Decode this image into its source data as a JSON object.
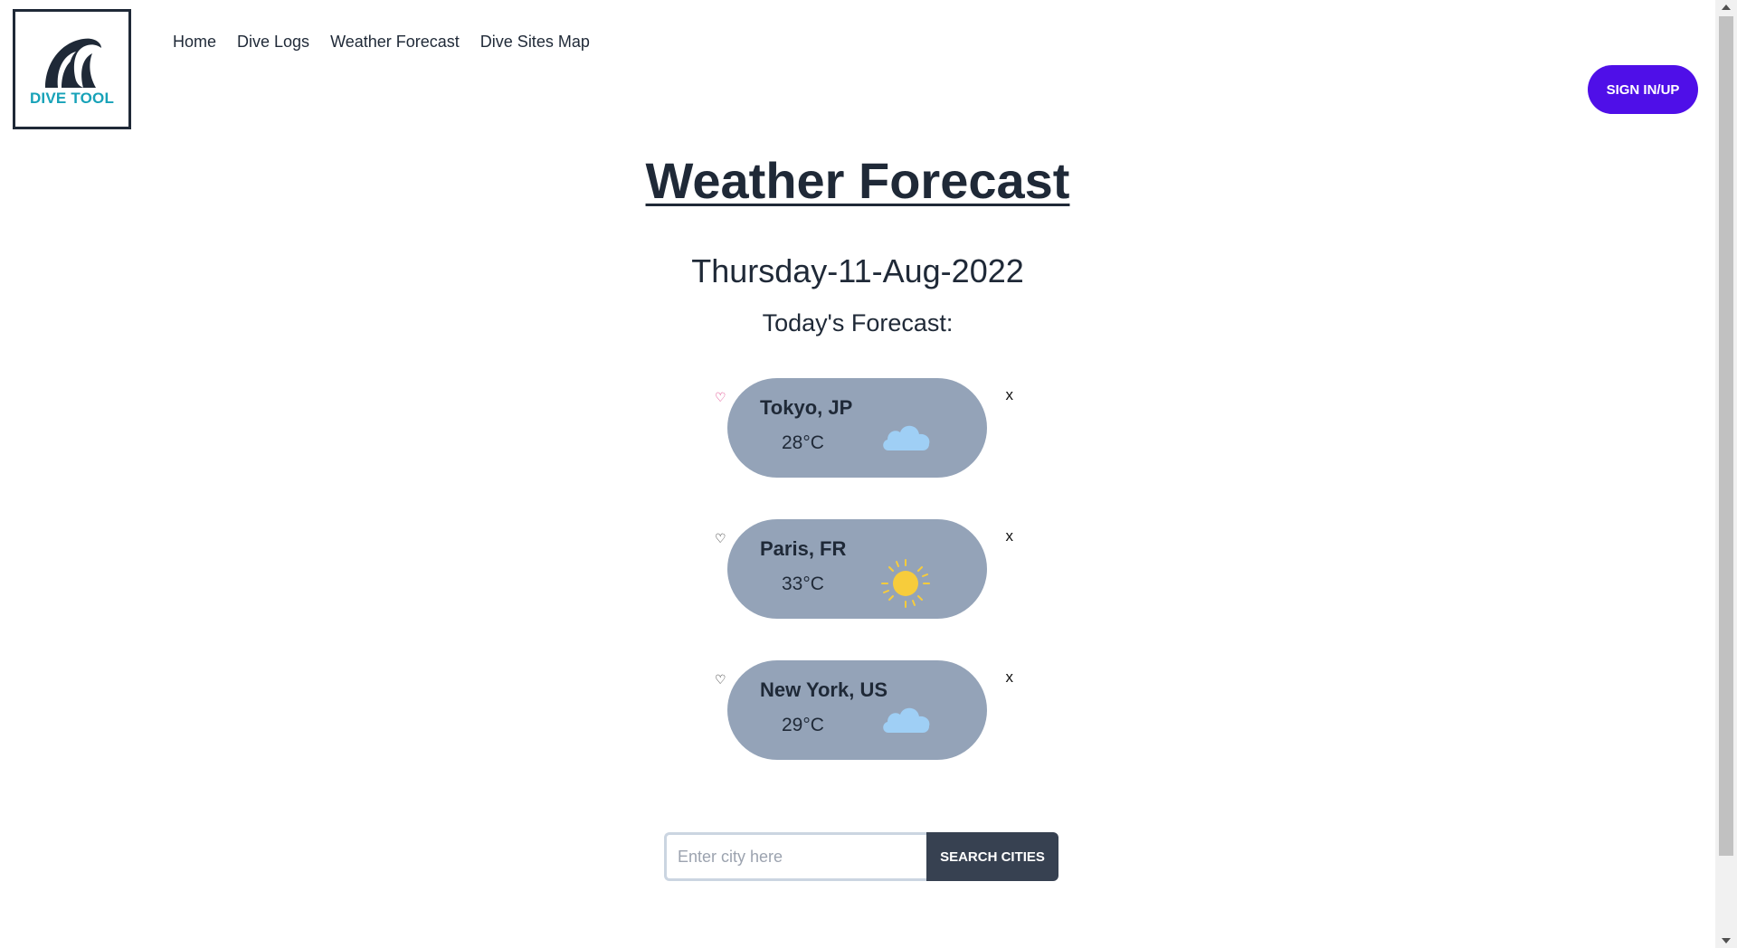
{
  "header": {
    "logo_text": "DIVE TOOL",
    "nav": [
      {
        "label": "Home"
      },
      {
        "label": "Dive Logs"
      },
      {
        "label": "Weather Forecast"
      },
      {
        "label": "Dive Sites Map"
      }
    ],
    "signin_label": "SIGN IN/UP",
    "accent_color": "#4f0fe8",
    "logo_color": "#17a2b8"
  },
  "main": {
    "title": "Weather Forecast",
    "date": "Thursday-11-Aug-2022",
    "forecast_label": "Today's Forecast:"
  },
  "cards": [
    {
      "city": "Tokyo, JP",
      "temp": "28°C",
      "icon": "cloud-icon",
      "favorite": true,
      "heart": "♡",
      "close": "x"
    },
    {
      "city": "Paris, FR",
      "temp": "33°C",
      "icon": "sun-icon",
      "favorite": false,
      "heart": "♡",
      "close": "x"
    },
    {
      "city": "New York, US",
      "temp": "29°C",
      "icon": "cloud-icon",
      "favorite": false,
      "heart": "♡",
      "close": "x"
    }
  ],
  "search": {
    "placeholder": "Enter city here",
    "value": "",
    "button_label": "SEARCH CITIES"
  },
  "colors": {
    "card_bg": "#94a3b8",
    "favorite_heart": "#db2777",
    "default_heart": "#111111",
    "cloud": "#9fcff5",
    "sun": "#f7cc3b",
    "search_button": "#374151"
  }
}
